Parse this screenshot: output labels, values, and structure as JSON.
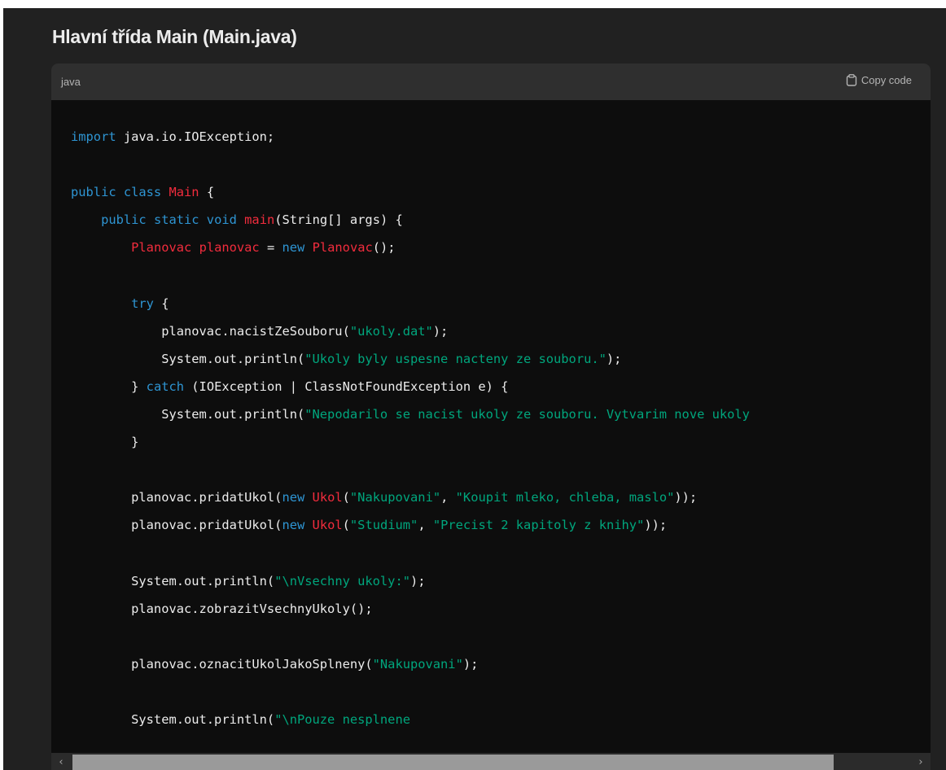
{
  "heading": "Hlavní třída Main (Main.java)",
  "code_block": {
    "language": "java",
    "copy_label": "Copy code",
    "copy_icon": "clipboard-icon",
    "lines": [
      [
        [
          "kw",
          "import"
        ],
        [
          "pl",
          " java.io.IOException;"
        ]
      ],
      [],
      [
        [
          "kw",
          "public class"
        ],
        [
          "pl",
          " "
        ],
        [
          "ty",
          "Main"
        ],
        [
          "pl",
          " {"
        ]
      ],
      [
        [
          "pl",
          "    "
        ],
        [
          "kw",
          "public static void"
        ],
        [
          "pl",
          " "
        ],
        [
          "ty",
          "main"
        ],
        [
          "pl",
          "(String[] args) {"
        ]
      ],
      [
        [
          "pl",
          "        "
        ],
        [
          "ty",
          "Planovac"
        ],
        [
          "pl",
          " "
        ],
        [
          "ty",
          "planovac"
        ],
        [
          "pl",
          " = "
        ],
        [
          "kw",
          "new"
        ],
        [
          "pl",
          " "
        ],
        [
          "ty",
          "Planovac"
        ],
        [
          "pl",
          "();"
        ]
      ],
      [],
      [
        [
          "pl",
          "        "
        ],
        [
          "kw",
          "try"
        ],
        [
          "pl",
          " {"
        ]
      ],
      [
        [
          "pl",
          "            planovac.nacistZeSouboru("
        ],
        [
          "str",
          "\"ukoly.dat\""
        ],
        [
          "pl",
          ");"
        ]
      ],
      [
        [
          "pl",
          "            System.out.println("
        ],
        [
          "str",
          "\"Ukoly byly uspesne nacteny ze souboru.\""
        ],
        [
          "pl",
          ");"
        ]
      ],
      [
        [
          "pl",
          "        } "
        ],
        [
          "kw",
          "catch"
        ],
        [
          "pl",
          " (IOException | ClassNotFoundException e) {"
        ]
      ],
      [
        [
          "pl",
          "            System.out.println("
        ],
        [
          "str",
          "\"Nepodarilo se nacist ukoly ze souboru. Vytvarim nove ukoly"
        ]
      ],
      [
        [
          "pl",
          "        }"
        ]
      ],
      [],
      [
        [
          "pl",
          "        planovac.pridatUkol("
        ],
        [
          "kw",
          "new"
        ],
        [
          "pl",
          " "
        ],
        [
          "ty",
          "Ukol"
        ],
        [
          "pl",
          "("
        ],
        [
          "str",
          "\"Nakupovani\""
        ],
        [
          "pl",
          ", "
        ],
        [
          "str",
          "\"Koupit mleko, chleba, maslo\""
        ],
        [
          "pl",
          "));"
        ]
      ],
      [
        [
          "pl",
          "        planovac.pridatUkol("
        ],
        [
          "kw",
          "new"
        ],
        [
          "pl",
          " "
        ],
        [
          "ty",
          "Ukol"
        ],
        [
          "pl",
          "("
        ],
        [
          "str",
          "\"Studium\""
        ],
        [
          "pl",
          ", "
        ],
        [
          "str",
          "\"Precist 2 kapitoly z knihy\""
        ],
        [
          "pl",
          "));"
        ]
      ],
      [],
      [
        [
          "pl",
          "        System.out.println("
        ],
        [
          "str",
          "\"\\nVsechny ukoly:\""
        ],
        [
          "pl",
          ");"
        ]
      ],
      [
        [
          "pl",
          "        planovac.zobrazitVsechnyUkoly();"
        ]
      ],
      [],
      [
        [
          "pl",
          "        planovac.oznacitUkolJakoSplneny("
        ],
        [
          "str",
          "\"Nakupovani\""
        ],
        [
          "pl",
          ");"
        ]
      ],
      [],
      [
        [
          "pl",
          "        System.out.println("
        ],
        [
          "str",
          "\"\\nPouze nesplnene"
        ]
      ]
    ],
    "colors": {
      "keyword": "#2e95d3",
      "type": "#f22c3d",
      "string": "#00a67d",
      "plain": "#ececec",
      "background": "#0d0d0d",
      "header": "#2f2f2f"
    },
    "scrollbar": {
      "thumb_fraction": 0.91,
      "position_fraction": 0.0,
      "left_arrow": "‹",
      "right_arrow": "›"
    }
  }
}
